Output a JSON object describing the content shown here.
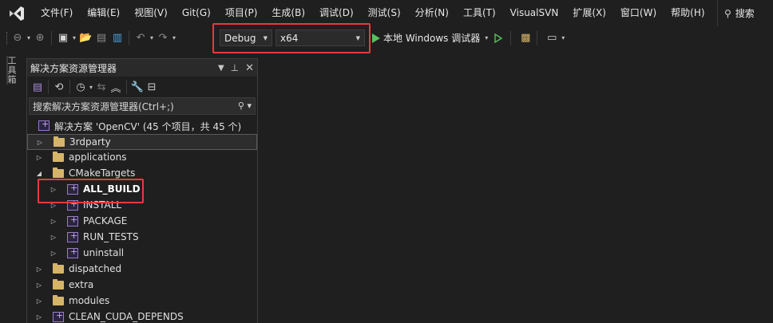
{
  "menu": {
    "items": [
      "文件(F)",
      "编辑(E)",
      "视图(V)",
      "Git(G)",
      "项目(P)",
      "生成(B)",
      "调试(D)",
      "测试(S)",
      "分析(N)",
      "工具(T)",
      "VisualSVN",
      "扩展(X)",
      "窗口(W)",
      "帮助(H)"
    ],
    "search_label": "搜索"
  },
  "toolbar": {
    "configuration": "Debug",
    "platform": "x64",
    "run_label": "本地 Windows 调试器"
  },
  "left_strip": {
    "tab_label": "工具箱"
  },
  "solution_explorer": {
    "title": "解决方案资源管理器",
    "search_placeholder": "搜索解决方案资源管理器(Ctrl+;)",
    "solution_label": "解决方案 'OpenCV' (45 个项目，共 45 个)",
    "nodes": [
      {
        "label": "3rdparty",
        "type": "folder",
        "level": 0,
        "expanded": false,
        "selected": true
      },
      {
        "label": "applications",
        "type": "folder",
        "level": 0,
        "expanded": false
      },
      {
        "label": "CMakeTargets",
        "type": "folder",
        "level": 0,
        "expanded": true
      },
      {
        "label": "ALL_BUILD",
        "type": "project",
        "level": 1,
        "expanded": false,
        "bold": true
      },
      {
        "label": "INSTALL",
        "type": "project",
        "level": 1,
        "expanded": false
      },
      {
        "label": "PACKAGE",
        "type": "project",
        "level": 1,
        "expanded": false
      },
      {
        "label": "RUN_TESTS",
        "type": "project",
        "level": 1,
        "expanded": false
      },
      {
        "label": "uninstall",
        "type": "project",
        "level": 1,
        "expanded": false
      },
      {
        "label": "dispatched",
        "type": "folder",
        "level": 0,
        "expanded": false
      },
      {
        "label": "extra",
        "type": "folder",
        "level": 0,
        "expanded": false
      },
      {
        "label": "modules",
        "type": "folder",
        "level": 0,
        "expanded": false
      },
      {
        "label": "CLEAN_CUDA_DEPENDS",
        "type": "project",
        "level": 0,
        "expanded": false
      }
    ]
  },
  "colors": {
    "highlight": "#e8393e",
    "run_green": "#57c15a",
    "folder": "#d6b56a",
    "vs_purple": "#9a7acc"
  }
}
